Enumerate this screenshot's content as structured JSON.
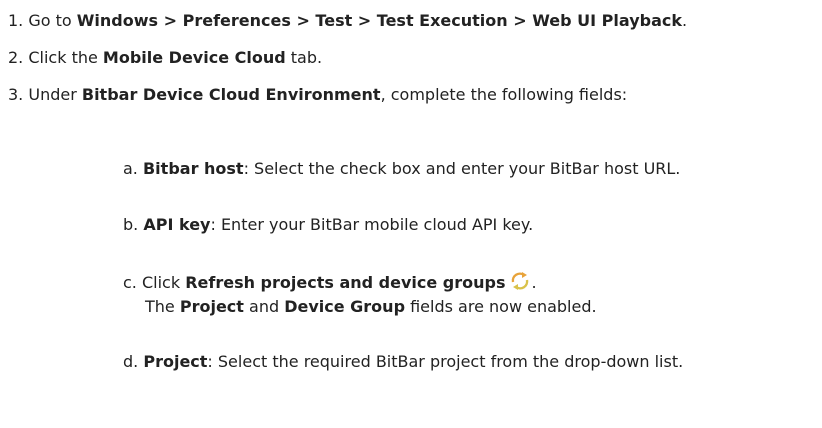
{
  "steps": [
    {
      "num": "1.",
      "pre": " Go to ",
      "bold": "Windows > Preferences > Test > Test Execution > Web UI Playback",
      "post": "."
    },
    {
      "num": "2.",
      "pre": " Click the ",
      "bold": "Mobile Device Cloud",
      "post": " tab."
    },
    {
      "num": "3.",
      "pre": " Under ",
      "bold": "Bitbar Device Cloud Environment",
      "post": ", complete the following fields:"
    }
  ],
  "substeps": [
    {
      "letter": "a.",
      "bold": "Bitbar host",
      "post": ": Select the check box and enter your BitBar host URL."
    },
    {
      "letter": "b.",
      "bold": "API key",
      "post": ": Enter your BitBar mobile cloud API key."
    },
    {
      "letter": "c.",
      "pre": " Click ",
      "bold": "Refresh projects and device groups",
      "post": ".",
      "icon": "refresh-icon"
    },
    {
      "letter": "d.",
      "bold": "Project",
      "post": ": Select the required BitBar project from the drop-down list."
    }
  ],
  "note_c": {
    "pre": "The ",
    "bold1": "Project",
    "mid": " and ",
    "bold2": "Device Group",
    "post": " fields are now enabled."
  }
}
